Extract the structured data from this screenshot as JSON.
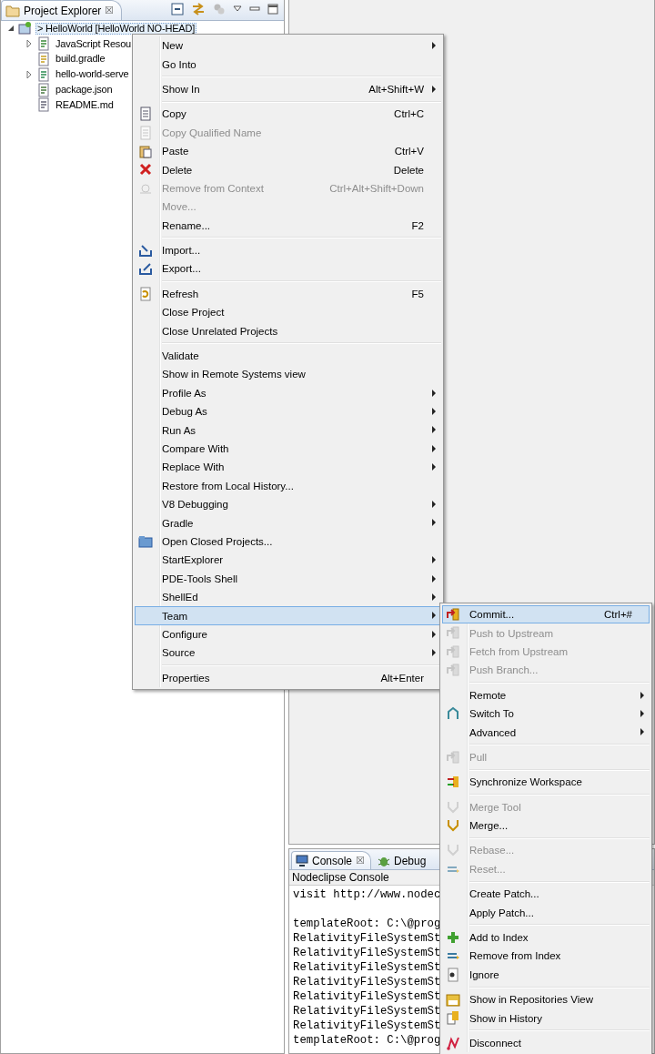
{
  "project_explorer": {
    "tab": {
      "title": "Project Explorer",
      "close": "☒"
    },
    "tree": [
      {
        "label": "> HelloWorld  [HelloWorld NO-HEAD]",
        "selected": true,
        "expanded": true,
        "children": [
          {
            "label": "JavaScript Resou",
            "expanded": false,
            "selected": false
          },
          {
            "label": "build.gradle",
            "selected": false
          },
          {
            "label": "hello-world-serve",
            "expanded": false,
            "selected": false
          },
          {
            "label": "package.json",
            "selected": false
          },
          {
            "label": "README.md",
            "selected": false
          }
        ]
      }
    ]
  },
  "console": {
    "tabs": [
      {
        "label": "Console",
        "close": "☒",
        "selected": true
      },
      {
        "label": "Debug",
        "selected": false
      }
    ],
    "title": "Nodeclipse Console",
    "blocks": [
      [
        "visit http://www.nodec"
      ],
      [
        "templateRoot: C:\\@prog",
        "RelativityFileSystemSt",
        "RelativityFileSystemSt",
        "RelativityFileSystemSt",
        "RelativityFileSystemSt",
        "RelativityFileSystemSt",
        "RelativityFileSystemSt",
        "RelativityFileSystemSt",
        "templateRoot: C:\\@prog"
      ]
    ]
  },
  "context_menu": {
    "items": [
      {
        "kind": "item",
        "label": "New",
        "submenu": true,
        "disabled": false,
        "selected": false
      },
      {
        "kind": "item",
        "label": "Go Into",
        "disabled": false,
        "selected": false
      },
      {
        "kind": "separator"
      },
      {
        "kind": "item",
        "label": "Show In",
        "shortcut": "Alt+Shift+W",
        "submenu": true,
        "disabled": false,
        "selected": false
      },
      {
        "kind": "separator"
      },
      {
        "kind": "item",
        "label": "Copy",
        "shortcut": "Ctrl+C",
        "disabled": false,
        "selected": false
      },
      {
        "kind": "item",
        "label": "Copy Qualified Name",
        "disabled": true,
        "selected": false
      },
      {
        "kind": "item",
        "label": "Paste",
        "shortcut": "Ctrl+V",
        "disabled": false,
        "selected": false
      },
      {
        "kind": "item",
        "label": "Delete",
        "shortcut": "Delete",
        "disabled": false,
        "selected": false
      },
      {
        "kind": "item",
        "label": "Remove from Context",
        "shortcut": "Ctrl+Alt+Shift+Down",
        "disabled": true,
        "selected": false
      },
      {
        "kind": "item",
        "label": "Move...",
        "disabled": true,
        "selected": false
      },
      {
        "kind": "item",
        "label": "Rename...",
        "shortcut": "F2",
        "disabled": false,
        "selected": false
      },
      {
        "kind": "separator"
      },
      {
        "kind": "item",
        "label": "Import...",
        "disabled": false,
        "selected": false
      },
      {
        "kind": "item",
        "label": "Export...",
        "disabled": false,
        "selected": false
      },
      {
        "kind": "separator"
      },
      {
        "kind": "item",
        "label": "Refresh",
        "shortcut": "F5",
        "disabled": false,
        "selected": false
      },
      {
        "kind": "item",
        "label": "Close Project",
        "disabled": false,
        "selected": false
      },
      {
        "kind": "item",
        "label": "Close Unrelated Projects",
        "disabled": false,
        "selected": false
      },
      {
        "kind": "separator"
      },
      {
        "kind": "item",
        "label": "Validate",
        "disabled": false,
        "selected": false
      },
      {
        "kind": "item",
        "label": "Show in Remote Systems view",
        "disabled": false,
        "selected": false
      },
      {
        "kind": "item",
        "label": "Profile As",
        "submenu": true,
        "disabled": false,
        "selected": false
      },
      {
        "kind": "item",
        "label": "Debug As",
        "submenu": true,
        "disabled": false,
        "selected": false
      },
      {
        "kind": "item",
        "label": "Run As",
        "submenu": true,
        "disabled": false,
        "selected": false
      },
      {
        "kind": "item",
        "label": "Compare With",
        "submenu": true,
        "disabled": false,
        "selected": false
      },
      {
        "kind": "item",
        "label": "Replace With",
        "submenu": true,
        "disabled": false,
        "selected": false
      },
      {
        "kind": "item",
        "label": "Restore from Local History...",
        "disabled": false,
        "selected": false
      },
      {
        "kind": "item",
        "label": "V8 Debugging",
        "submenu": true,
        "disabled": false,
        "selected": false
      },
      {
        "kind": "item",
        "label": "Gradle",
        "submenu": true,
        "disabled": false,
        "selected": false
      },
      {
        "kind": "item",
        "label": "Open Closed Projects...",
        "disabled": false,
        "selected": false
      },
      {
        "kind": "item",
        "label": "StartExplorer",
        "submenu": true,
        "disabled": false,
        "selected": false
      },
      {
        "kind": "item",
        "label": "PDE-Tools Shell",
        "submenu": true,
        "disabled": false,
        "selected": false
      },
      {
        "kind": "item",
        "label": "ShellEd",
        "submenu": true,
        "disabled": false,
        "selected": false
      },
      {
        "kind": "item",
        "label": "Team",
        "submenu": true,
        "disabled": false,
        "selected": true
      },
      {
        "kind": "item",
        "label": "Configure",
        "submenu": true,
        "disabled": false,
        "selected": false
      },
      {
        "kind": "item",
        "label": "Source",
        "submenu": true,
        "disabled": false,
        "selected": false
      },
      {
        "kind": "separator"
      },
      {
        "kind": "item",
        "label": "Properties",
        "shortcut": "Alt+Enter",
        "disabled": false,
        "selected": false
      }
    ]
  },
  "team_submenu": {
    "items": [
      {
        "kind": "item",
        "label": "Commit...",
        "shortcut": "Ctrl+#",
        "disabled": false,
        "selected": true
      },
      {
        "kind": "item",
        "label": "Push to Upstream",
        "disabled": true,
        "selected": false
      },
      {
        "kind": "item",
        "label": "Fetch from Upstream",
        "disabled": true,
        "selected": false
      },
      {
        "kind": "item",
        "label": "Push Branch...",
        "disabled": true,
        "selected": false
      },
      {
        "kind": "separator"
      },
      {
        "kind": "item",
        "label": "Remote",
        "submenu": true,
        "disabled": false,
        "selected": false
      },
      {
        "kind": "item",
        "label": "Switch To",
        "submenu": true,
        "disabled": false,
        "selected": false
      },
      {
        "kind": "item",
        "label": "Advanced",
        "submenu": true,
        "disabled": false,
        "selected": false
      },
      {
        "kind": "separator"
      },
      {
        "kind": "item",
        "label": "Pull",
        "disabled": true,
        "selected": false
      },
      {
        "kind": "separator"
      },
      {
        "kind": "item",
        "label": "Synchronize Workspace",
        "disabled": false,
        "selected": false
      },
      {
        "kind": "separator"
      },
      {
        "kind": "item",
        "label": "Merge Tool",
        "disabled": true,
        "selected": false
      },
      {
        "kind": "item",
        "label": "Merge...",
        "disabled": false,
        "selected": false
      },
      {
        "kind": "separator"
      },
      {
        "kind": "item",
        "label": "Rebase...",
        "disabled": true,
        "selected": false
      },
      {
        "kind": "item",
        "label": "Reset...",
        "disabled": true,
        "selected": false
      },
      {
        "kind": "separator"
      },
      {
        "kind": "item",
        "label": "Create Patch...",
        "disabled": false,
        "selected": false
      },
      {
        "kind": "item",
        "label": "Apply Patch...",
        "disabled": false,
        "selected": false
      },
      {
        "kind": "separator"
      },
      {
        "kind": "item",
        "label": "Add to Index",
        "disabled": false,
        "selected": false
      },
      {
        "kind": "item",
        "label": "Remove from Index",
        "disabled": false,
        "selected": false
      },
      {
        "kind": "item",
        "label": "Ignore",
        "disabled": false,
        "selected": false
      },
      {
        "kind": "separator"
      },
      {
        "kind": "item",
        "label": "Show in Repositories View",
        "disabled": false,
        "selected": false
      },
      {
        "kind": "item",
        "label": "Show in History",
        "disabled": false,
        "selected": false
      },
      {
        "kind": "separator"
      },
      {
        "kind": "item",
        "label": "Disconnect",
        "disabled": false,
        "selected": false
      }
    ]
  }
}
